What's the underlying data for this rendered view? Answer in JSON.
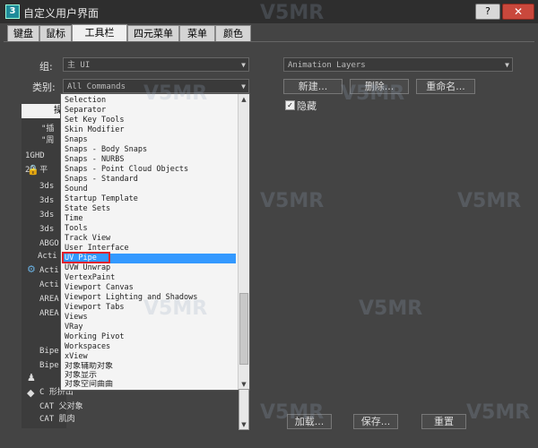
{
  "window": {
    "title": "自定义用户界面",
    "help_label": "?",
    "close_label": "✕"
  },
  "tabs": [
    {
      "label": "键盘"
    },
    {
      "label": "鼠标"
    },
    {
      "label": "工具栏",
      "active": true
    },
    {
      "label": "四元菜单"
    },
    {
      "label": "菜单"
    },
    {
      "label": "颜色"
    }
  ],
  "group": {
    "label": "组:",
    "value": "主 UI"
  },
  "category": {
    "label": "类别:",
    "value": "All Commands"
  },
  "left_list": {
    "header": "操",
    "items": [
      "\"插",
      "\"周",
      "1GHD",
      "2D 平",
      "3ds",
      "3ds",
      "3ds",
      "3ds",
      "ABGO",
      "Acti",
      "Acti",
      "Acti",
      "AREA",
      "AREA",
      "Bipe",
      "Bipe",
      "C 形挤出",
      "CAT 父对象",
      "CAT 肌肉"
    ]
  },
  "dropdown": {
    "items": [
      "Selection",
      "Separator",
      "Set Key Tools",
      "Skin Modifier",
      "Snaps",
      "Snaps - Body Snaps",
      "Snaps - NURBS",
      "Snaps - Point Cloud Objects",
      "Snaps - Standard",
      "Sound",
      "Startup Template",
      "State Sets",
      "Time",
      "Tools",
      "Track View",
      "User Interface",
      "UV Pipe",
      "UVW Unwrap",
      "VertexPaint",
      "Viewport Canvas",
      "Viewport Lighting and Shadows",
      "Viewport Tabs",
      "Views",
      "VRay",
      "Working Pivot",
      "Workspaces",
      "xView",
      "对象辅助对象",
      "对象显示",
      "对象空间曲曲"
    ],
    "selected": "UV Pipe"
  },
  "right": {
    "combo_value": "Animation Layers",
    "new_label": "新建...",
    "delete_label": "删除...",
    "rename_label": "重命名...",
    "hide_label": "隐藏"
  },
  "bottom": {
    "load_label": "加载...",
    "save_label": "保存...",
    "reset_label": "重置"
  },
  "watermark": "V5MR",
  "colors": {
    "selection": "#3399ff",
    "highlight_box": "#e0202a",
    "close": "#c9483c"
  }
}
